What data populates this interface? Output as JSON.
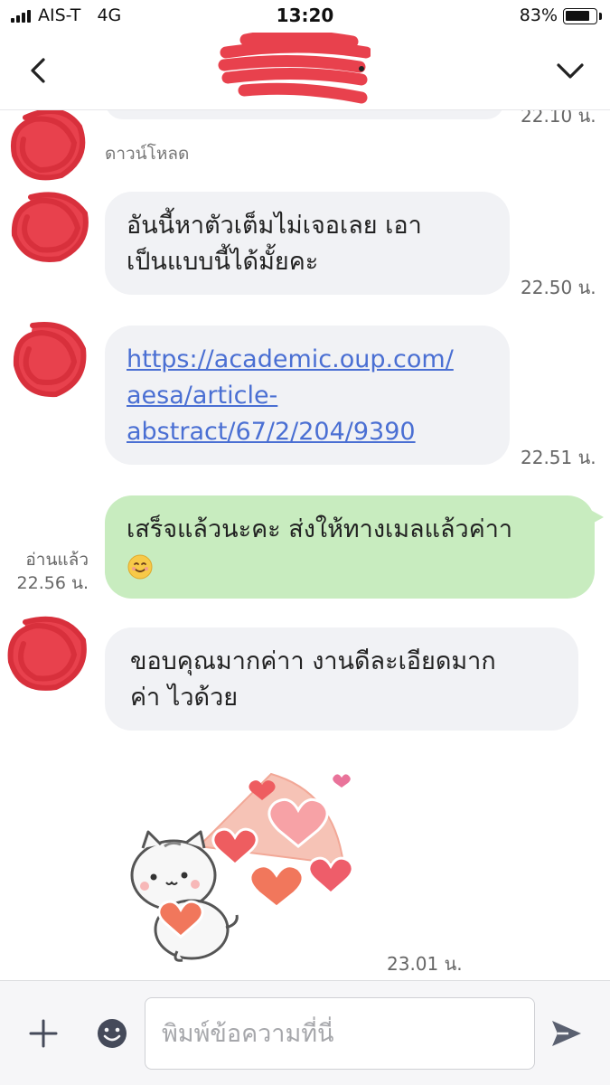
{
  "status_bar": {
    "carrier": "AIS-T",
    "network": "4G",
    "time": "13:20",
    "battery_percent": "83%",
    "battery_level": 0.83
  },
  "header": {
    "back_icon": "chevron-left-icon",
    "menu_icon": "chevron-down-icon"
  },
  "messages": [
    {
      "type": "received",
      "time": "22.10 น."
    },
    {
      "type": "sender-note",
      "text": "ดาวน์โหลด"
    },
    {
      "type": "received",
      "text": "อันนี้หาตัวเต็มไม่เจอเลย เอา\nเป็นแบบนี้ได้มั้ยคะ",
      "time": "22.50 น."
    },
    {
      "type": "received",
      "text": "https://academic.oup.com/\naesa/article-\nabstract/67/2/204/9390",
      "time": "22.51 น.",
      "is_link": true
    },
    {
      "type": "sent",
      "text": "เสร็จแล้วนะคะ ส่งให้ทางเมลแล้วค่าา",
      "emoji": "smiling-face-emoji",
      "read_label": "อ่านแล้ว",
      "time": "22.56 น."
    },
    {
      "type": "received",
      "text": "ขอบคุณมากค่าา งานดีละเอียดมาก\nค่า ไวด้วย"
    },
    {
      "type": "sticker",
      "sticker": "cat-hearts-sticker",
      "time": "23.01 น."
    }
  ],
  "input_bar": {
    "plus_icon": "plus-icon",
    "emoji_icon": "emoji-icon",
    "placeholder": "พิมพ์ข้อความที่นี่",
    "send_icon": "send-icon"
  },
  "colors": {
    "received_bubble": "#f1f2f5",
    "sent_bubble": "#c8ecbf",
    "link": "#4a6fd3",
    "redaction": "#e8414d"
  }
}
